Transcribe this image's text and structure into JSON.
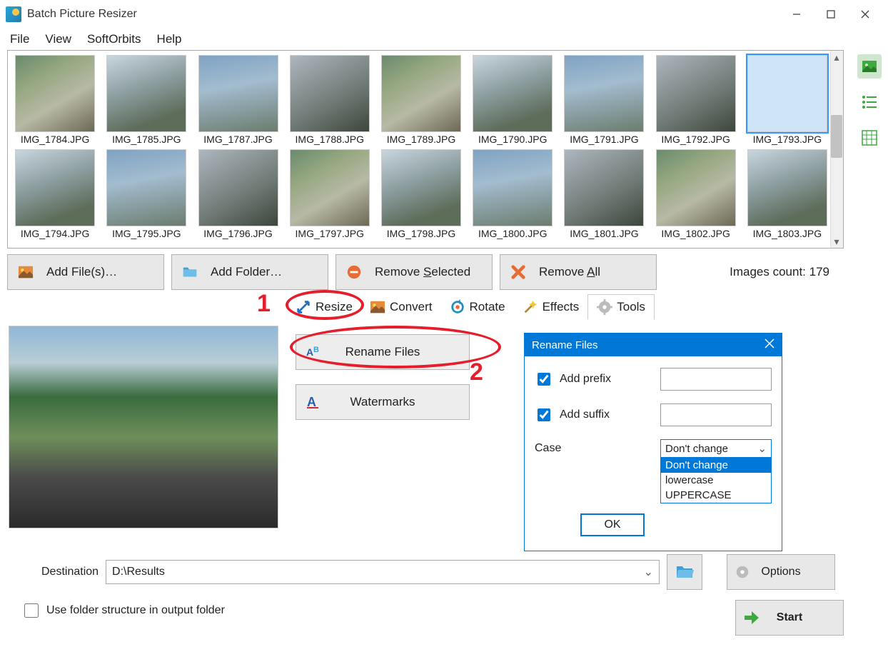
{
  "app_title": "Batch Picture Resizer",
  "menu": [
    "File",
    "View",
    "SoftOrbits",
    "Help"
  ],
  "thumbnails_row1": [
    "IMG_1784.JPG",
    "IMG_1785.JPG",
    "IMG_1787.JPG",
    "IMG_1788.JPG",
    "IMG_1789.JPG",
    "IMG_1790.JPG",
    "IMG_1791.JPG",
    "IMG_1792.JPG",
    "IMG_1793.JPG"
  ],
  "thumbnails_row2": [
    "IMG_1794.JPG",
    "IMG_1795.JPG",
    "IMG_1796.JPG",
    "IMG_1797.JPG",
    "IMG_1798.JPG",
    "IMG_1800.JPG",
    "IMG_1801.JPG",
    "IMG_1802.JPG",
    "IMG_1803.JPG"
  ],
  "selected_thumbnail": "IMG_1793.JPG",
  "actions": {
    "add_files": "Add File(s)…",
    "add_folder": "Add Folder…",
    "remove_selected_pre": "Remove ",
    "remove_selected_u": "S",
    "remove_selected_post": "elected",
    "remove_all_pre": "Remove ",
    "remove_all_u": "A",
    "remove_all_post": "ll"
  },
  "images_count_label": "Images count: 179",
  "tabs": {
    "resize": "Resize",
    "convert": "Convert",
    "rotate": "Rotate",
    "effects": "Effects",
    "tools": "Tools"
  },
  "annotations": {
    "one": "1",
    "two": "2"
  },
  "tool_buttons": {
    "rename": "Rename Files",
    "watermarks": "Watermarks"
  },
  "dialog": {
    "title": "Rename Files",
    "add_prefix": "Add prefix",
    "add_suffix": "Add suffix",
    "case": "Case",
    "case_selected": "Don't change",
    "case_options": [
      "Don't change",
      "lowercase",
      "UPPERCASE"
    ],
    "ok": "OK"
  },
  "destination": {
    "label": "Destination",
    "value": "D:\\Results"
  },
  "use_folder_structure": "Use folder structure in output folder",
  "options_btn": "Options",
  "start_btn": "Start"
}
